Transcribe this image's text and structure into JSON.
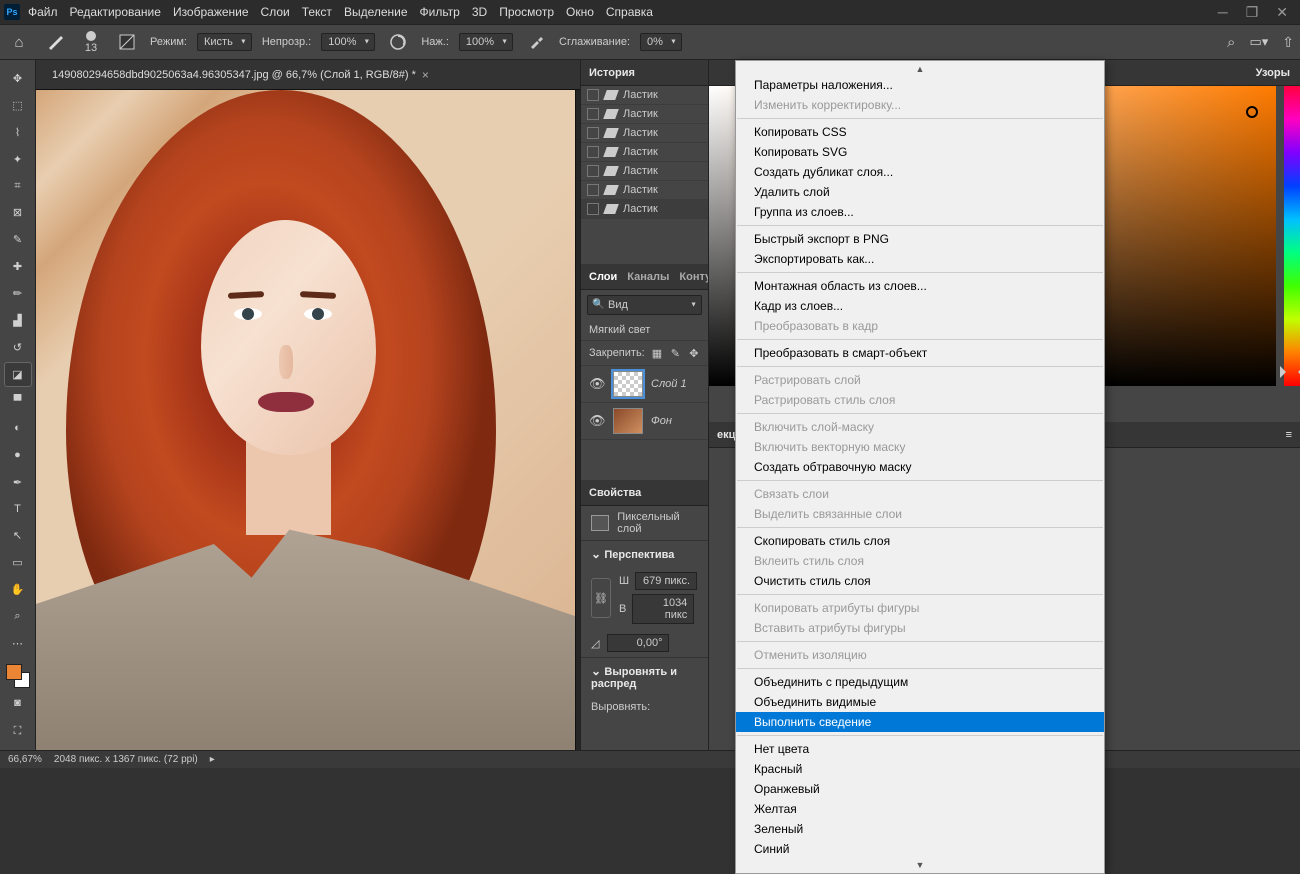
{
  "menu": {
    "items": [
      "Файл",
      "Редактирование",
      "Изображение",
      "Слои",
      "Текст",
      "Выделение",
      "Фильтр",
      "3D",
      "Просмотр",
      "Окно",
      "Справка"
    ]
  },
  "options": {
    "brush_size": "13",
    "mode_label": "Режим:",
    "mode_value": "Кисть",
    "opacity_label": "Непрозр.:",
    "opacity_value": "100%",
    "flow_label": "Наж.:",
    "flow_value": "100%",
    "smoothing_label": "Сглаживание:",
    "smoothing_value": "0%"
  },
  "doc": {
    "tab_title": "149080294658dbd9025063a4.96305347.jpg @ 66,7% (Слой 1, RGB/8#) *"
  },
  "history": {
    "title": "История",
    "items": [
      "Ластик",
      "Ластик",
      "Ластик",
      "Ластик",
      "Ластик",
      "Ластик",
      "Ластик"
    ]
  },
  "layers_panel": {
    "tabs": [
      "Слои",
      "Каналы",
      "Конту"
    ],
    "filter_label": "Вид",
    "blend_mode": "Мягкий свет",
    "lock_label": "Закрепить:",
    "layers": [
      {
        "name": "Слой 1"
      },
      {
        "name": "Фон"
      }
    ]
  },
  "properties": {
    "title": "Свойства",
    "type_label": "Пиксельный слой",
    "perspective_label": "Перспектива",
    "w_label": "Ш",
    "w_value": "679 пикс.",
    "h_label": "В",
    "h_value": "1034 пикс",
    "angle_value": "0,00°",
    "align_label": "Выровнять и распред",
    "align_sub": "Выровнять:"
  },
  "right_panel": {
    "tab_patterns": "Узоры",
    "tab_correction_suffix": "екция"
  },
  "status": {
    "zoom": "66,67%",
    "dims": "2048 пикс. x 1367 пикс. (72 ppi)"
  },
  "ctx": {
    "items": [
      {
        "t": "Параметры наложения...",
        "d": false
      },
      {
        "t": "Изменить корректировку...",
        "d": true
      },
      "sep",
      {
        "t": "Копировать CSS",
        "d": false
      },
      {
        "t": "Копировать SVG",
        "d": false
      },
      {
        "t": "Создать дубликат слоя...",
        "d": false
      },
      {
        "t": "Удалить слой",
        "d": false
      },
      {
        "t": "Группа из слоев...",
        "d": false
      },
      "sep",
      {
        "t": "Быстрый экспорт в PNG",
        "d": false
      },
      {
        "t": "Экспортировать как...",
        "d": false
      },
      "sep",
      {
        "t": "Монтажная область из слоев...",
        "d": false
      },
      {
        "t": "Кадр из слоев...",
        "d": false
      },
      {
        "t": "Преобразовать в кадр",
        "d": true
      },
      "sep",
      {
        "t": "Преобразовать в смарт-объект",
        "d": false
      },
      "sep",
      {
        "t": "Растрировать слой",
        "d": true
      },
      {
        "t": "Растрировать стиль слоя",
        "d": true
      },
      "sep",
      {
        "t": "Включить слой-маску",
        "d": true
      },
      {
        "t": "Включить векторную маску",
        "d": true
      },
      {
        "t": "Создать обтравочную маску",
        "d": false
      },
      "sep",
      {
        "t": "Связать слои",
        "d": true
      },
      {
        "t": "Выделить связанные слои",
        "d": true
      },
      "sep",
      {
        "t": "Скопировать стиль слоя",
        "d": false
      },
      {
        "t": "Вклеить стиль слоя",
        "d": true
      },
      {
        "t": "Очистить стиль слоя",
        "d": false
      },
      "sep",
      {
        "t": "Копировать атрибуты фигуры",
        "d": true
      },
      {
        "t": "Вставить атрибуты фигуры",
        "d": true
      },
      "sep",
      {
        "t": "Отменить изоляцию",
        "d": true
      },
      "sep",
      {
        "t": "Объединить с предыдущим",
        "d": false
      },
      {
        "t": "Объединить видимые",
        "d": false
      },
      {
        "t": "Выполнить сведение",
        "d": false,
        "hl": true
      },
      "sep",
      {
        "t": "Нет цвета",
        "d": false
      },
      {
        "t": "Красный",
        "d": false
      },
      {
        "t": "Оранжевый",
        "d": false
      },
      {
        "t": "Желтая",
        "d": false
      },
      {
        "t": "Зеленый",
        "d": false
      },
      {
        "t": "Синий",
        "d": false
      }
    ]
  }
}
